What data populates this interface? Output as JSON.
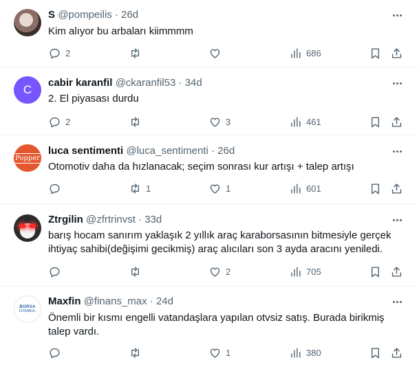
{
  "tweets": [
    {
      "name": "S",
      "handle": "@pompeilis",
      "separator": "·",
      "time": "26d",
      "avatar_letter": "",
      "text": "Kim alıyor bu arbaları kiimmmm",
      "replies": "2",
      "retweets": "",
      "likes": "",
      "views": "686",
      "avatar_icon": "person-photo"
    },
    {
      "name": "cabir karanfil",
      "handle": "@ckaranfil53",
      "separator": "·",
      "time": "34d",
      "avatar_letter": "C",
      "text": "2. El piyasası durdu",
      "replies": "2",
      "retweets": "",
      "likes": "3",
      "views": "461",
      "avatar_color": "#7856ff"
    },
    {
      "name": "luca sentimenti",
      "handle": "@luca_sentimenti",
      "separator": "·",
      "time": "26d",
      "avatar_letter": "Popper",
      "text": "Otomotiv daha da hızlanacak; seçim sonrası kur artışı + talep artışı",
      "replies": "",
      "retweets": "1",
      "likes": "1",
      "views": "601",
      "avatar_color": "#e4572e"
    },
    {
      "name": "Ztrgilin",
      "handle": "@zfrtrinvst",
      "separator": "·",
      "time": "33d",
      "avatar_letter": "",
      "text": "barış hocam sanırım yaklaşık 2 yıllık araç karaborsasının bitmesiyle  gerçek ihtiyaç sahibi(değişimi gecikmiş) araç alıcıları son 3 ayda aracını yeniledi.",
      "replies": "",
      "retweets": "",
      "likes": "2",
      "views": "705",
      "avatar_icon": "cat-laser-eyes"
    },
    {
      "name": "Maxfin",
      "handle": "@finans_max",
      "separator": "·",
      "time": "24d",
      "avatar_letter": "BORSA",
      "avatar_sub": "İSTANBUL",
      "text": "Önemli bir kısmı engelli vatandaşlara yapılan otvsiz satış. Burada birikmiş talep vardı.",
      "replies": "",
      "retweets": "",
      "likes": "1",
      "views": "380",
      "avatar_icon": "borsa-istanbul-logo"
    }
  ],
  "icons": {
    "reply": "reply-icon",
    "retweet": "retweet-icon",
    "like": "like-icon",
    "views": "views-icon",
    "bookmark": "bookmark-icon",
    "share": "share-icon",
    "more": "more-icon"
  },
  "colors": {
    "text": "#0f1419",
    "secondary": "#536471",
    "divider": "#eff3f4"
  }
}
